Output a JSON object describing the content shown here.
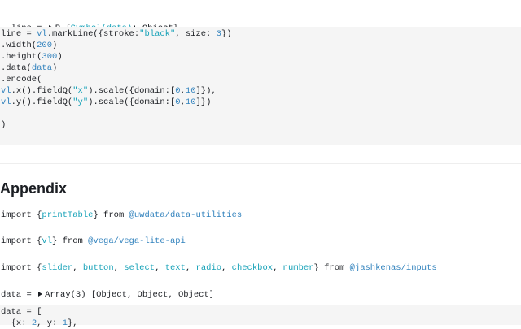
{
  "top_cell": {
    "var": "line",
    "eq": " = ",
    "type": "R",
    "symbol": "Symbol(data)",
    "rest": ": Object}"
  },
  "code1": {
    "l1_a": "line = ",
    "l1_vl": "vl",
    "l1_b": ".markLine({stroke:",
    "l1_str": "\"black\"",
    "l1_c": ", size: ",
    "l1_num": "3",
    "l1_d": "})",
    "l2_a": ".width(",
    "l2_num": "200",
    "l2_b": ")",
    "l3_a": ".height(",
    "l3_num": "300",
    "l3_b": ")",
    "l4_a": ".data(",
    "l4_data": "data",
    "l4_b": ")",
    "l5": ".encode(",
    "l6_vl": "vl",
    "l6_a": ".x().fieldQ(",
    "l6_str": "\"x\"",
    "l6_b": ").scale({domain:[",
    "l6_n1": "0",
    "l6_c": ",",
    "l6_n2": "10",
    "l6_d": "]}),",
    "l7_vl": "vl",
    "l7_a": ".y().fieldQ(",
    "l7_str": "\"y\"",
    "l7_b": ").scale({domain:[",
    "l7_n1": "0",
    "l7_c": ",",
    "l7_n2": "10",
    "l7_d": "]})",
    "l9": ")"
  },
  "appendix": {
    "title": "Appendix",
    "import1_a": "import {",
    "import1_name": "printTable",
    "import1_b": "} from ",
    "import1_src": "@uwdata/data-utilities",
    "import2_a": "import {",
    "import2_name": "vl",
    "import2_b": "} from ",
    "import2_src": "@vega/vega-lite-api",
    "import3_a": "import {",
    "import3_names": [
      "slider",
      "button",
      "select",
      "text",
      "radio",
      "checkbox",
      "number"
    ],
    "import3_b": "} from ",
    "import3_src": "@jashkenas/inputs",
    "data_var": "data",
    "data_eq": " = ",
    "data_type": "Array(3) [Object, Object, Object]"
  },
  "code2": {
    "l1": "data = [",
    "l2_a": "  {x: ",
    "l2_n1": "2",
    "l2_b": ", y: ",
    "l2_n2": "1",
    "l2_c": "},"
  }
}
